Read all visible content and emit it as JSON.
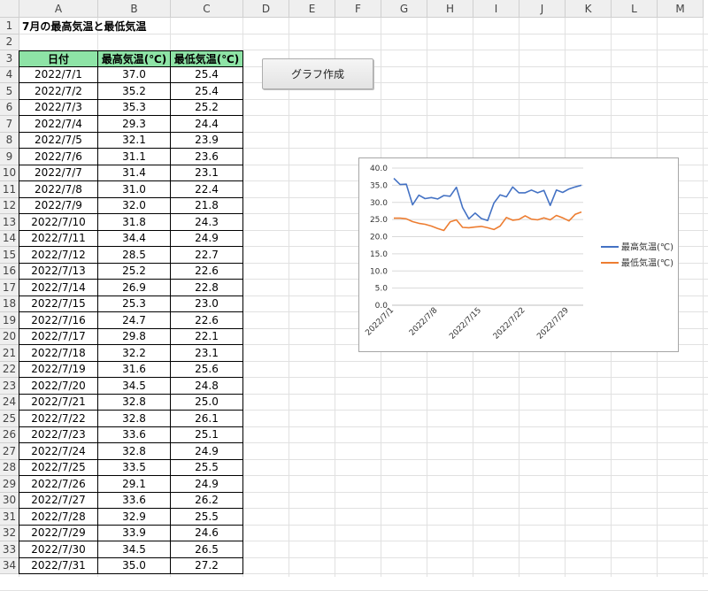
{
  "sheet": {
    "columns": [
      "A",
      "B",
      "C",
      "D",
      "E",
      "F",
      "G",
      "H",
      "I",
      "J",
      "K",
      "L",
      "M"
    ],
    "rows": [
      "1",
      "2",
      "3",
      "4",
      "5",
      "6",
      "7",
      "8",
      "9",
      "10",
      "11",
      "12",
      "13",
      "14",
      "15",
      "16",
      "17",
      "18",
      "19",
      "20",
      "21",
      "22",
      "23",
      "24",
      "25",
      "26",
      "27",
      "28",
      "29",
      "30",
      "31",
      "32",
      "33",
      "34"
    ],
    "title": "7月の最高気温と最低気温",
    "table_headers": [
      "日付",
      "最高気温(℃)",
      "最低気温(℃)"
    ],
    "table_rows": [
      [
        "2022/7/1",
        "37.0",
        "25.4"
      ],
      [
        "2022/7/2",
        "35.2",
        "25.4"
      ],
      [
        "2022/7/3",
        "35.3",
        "25.2"
      ],
      [
        "2022/7/4",
        "29.3",
        "24.4"
      ],
      [
        "2022/7/5",
        "32.1",
        "23.9"
      ],
      [
        "2022/7/6",
        "31.1",
        "23.6"
      ],
      [
        "2022/7/7",
        "31.4",
        "23.1"
      ],
      [
        "2022/7/8",
        "31.0",
        "22.4"
      ],
      [
        "2022/7/9",
        "32.0",
        "21.8"
      ],
      [
        "2022/7/10",
        "31.8",
        "24.3"
      ],
      [
        "2022/7/11",
        "34.4",
        "24.9"
      ],
      [
        "2022/7/12",
        "28.5",
        "22.7"
      ],
      [
        "2022/7/13",
        "25.2",
        "22.6"
      ],
      [
        "2022/7/14",
        "26.9",
        "22.8"
      ],
      [
        "2022/7/15",
        "25.3",
        "23.0"
      ],
      [
        "2022/7/16",
        "24.7",
        "22.6"
      ],
      [
        "2022/7/17",
        "29.8",
        "22.1"
      ],
      [
        "2022/7/18",
        "32.2",
        "23.1"
      ],
      [
        "2022/7/19",
        "31.6",
        "25.6"
      ],
      [
        "2022/7/20",
        "34.5",
        "24.8"
      ],
      [
        "2022/7/21",
        "32.8",
        "25.0"
      ],
      [
        "2022/7/22",
        "32.8",
        "26.1"
      ],
      [
        "2022/7/23",
        "33.6",
        "25.1"
      ],
      [
        "2022/7/24",
        "32.8",
        "24.9"
      ],
      [
        "2022/7/25",
        "33.5",
        "25.5"
      ],
      [
        "2022/7/26",
        "29.1",
        "24.9"
      ],
      [
        "2022/7/27",
        "33.6",
        "26.2"
      ],
      [
        "2022/7/28",
        "32.9",
        "25.5"
      ],
      [
        "2022/7/29",
        "33.9",
        "24.6"
      ],
      [
        "2022/7/30",
        "34.5",
        "26.5"
      ],
      [
        "2022/7/31",
        "35.0",
        "27.2"
      ]
    ],
    "button_label": "グラフ作成"
  },
  "chart_data": {
    "type": "line",
    "title": "",
    "xlabel": "",
    "ylabel": "",
    "x": [
      "2022/7/1",
      "2022/7/2",
      "2022/7/3",
      "2022/7/4",
      "2022/7/5",
      "2022/7/6",
      "2022/7/7",
      "2022/7/8",
      "2022/7/9",
      "2022/7/10",
      "2022/7/11",
      "2022/7/12",
      "2022/7/13",
      "2022/7/14",
      "2022/7/15",
      "2022/7/16",
      "2022/7/17",
      "2022/7/18",
      "2022/7/19",
      "2022/7/20",
      "2022/7/21",
      "2022/7/22",
      "2022/7/23",
      "2022/7/24",
      "2022/7/25",
      "2022/7/26",
      "2022/7/27",
      "2022/7/28",
      "2022/7/29",
      "2022/7/30",
      "2022/7/31"
    ],
    "x_tick_labels": [
      "2022/7/1",
      "2022/7/8",
      "2022/7/15",
      "2022/7/22",
      "2022/7/29"
    ],
    "x_tick_indices": [
      0,
      7,
      14,
      21,
      28
    ],
    "y_ticks": [
      "0.0",
      "5.0",
      "10.0",
      "15.0",
      "20.0",
      "25.0",
      "30.0",
      "35.0",
      "40.0"
    ],
    "ylim": [
      0,
      40
    ],
    "grid": true,
    "legend": "right",
    "series": [
      {
        "name": "最高気温(℃)",
        "color": "#4472c4",
        "values": [
          37.0,
          35.2,
          35.3,
          29.3,
          32.1,
          31.1,
          31.4,
          31.0,
          32.0,
          31.8,
          34.4,
          28.5,
          25.2,
          26.9,
          25.3,
          24.7,
          29.8,
          32.2,
          31.6,
          34.5,
          32.8,
          32.8,
          33.6,
          32.8,
          33.5,
          29.1,
          33.6,
          32.9,
          33.9,
          34.5,
          35.0
        ]
      },
      {
        "name": "最低気温(℃)",
        "color": "#ed7d31",
        "values": [
          25.4,
          25.4,
          25.2,
          24.4,
          23.9,
          23.6,
          23.1,
          22.4,
          21.8,
          24.3,
          24.9,
          22.7,
          22.6,
          22.8,
          23.0,
          22.6,
          22.1,
          23.1,
          25.6,
          24.8,
          25.0,
          26.1,
          25.1,
          24.9,
          25.5,
          24.9,
          26.2,
          25.5,
          24.6,
          26.5,
          27.2
        ]
      }
    ]
  }
}
